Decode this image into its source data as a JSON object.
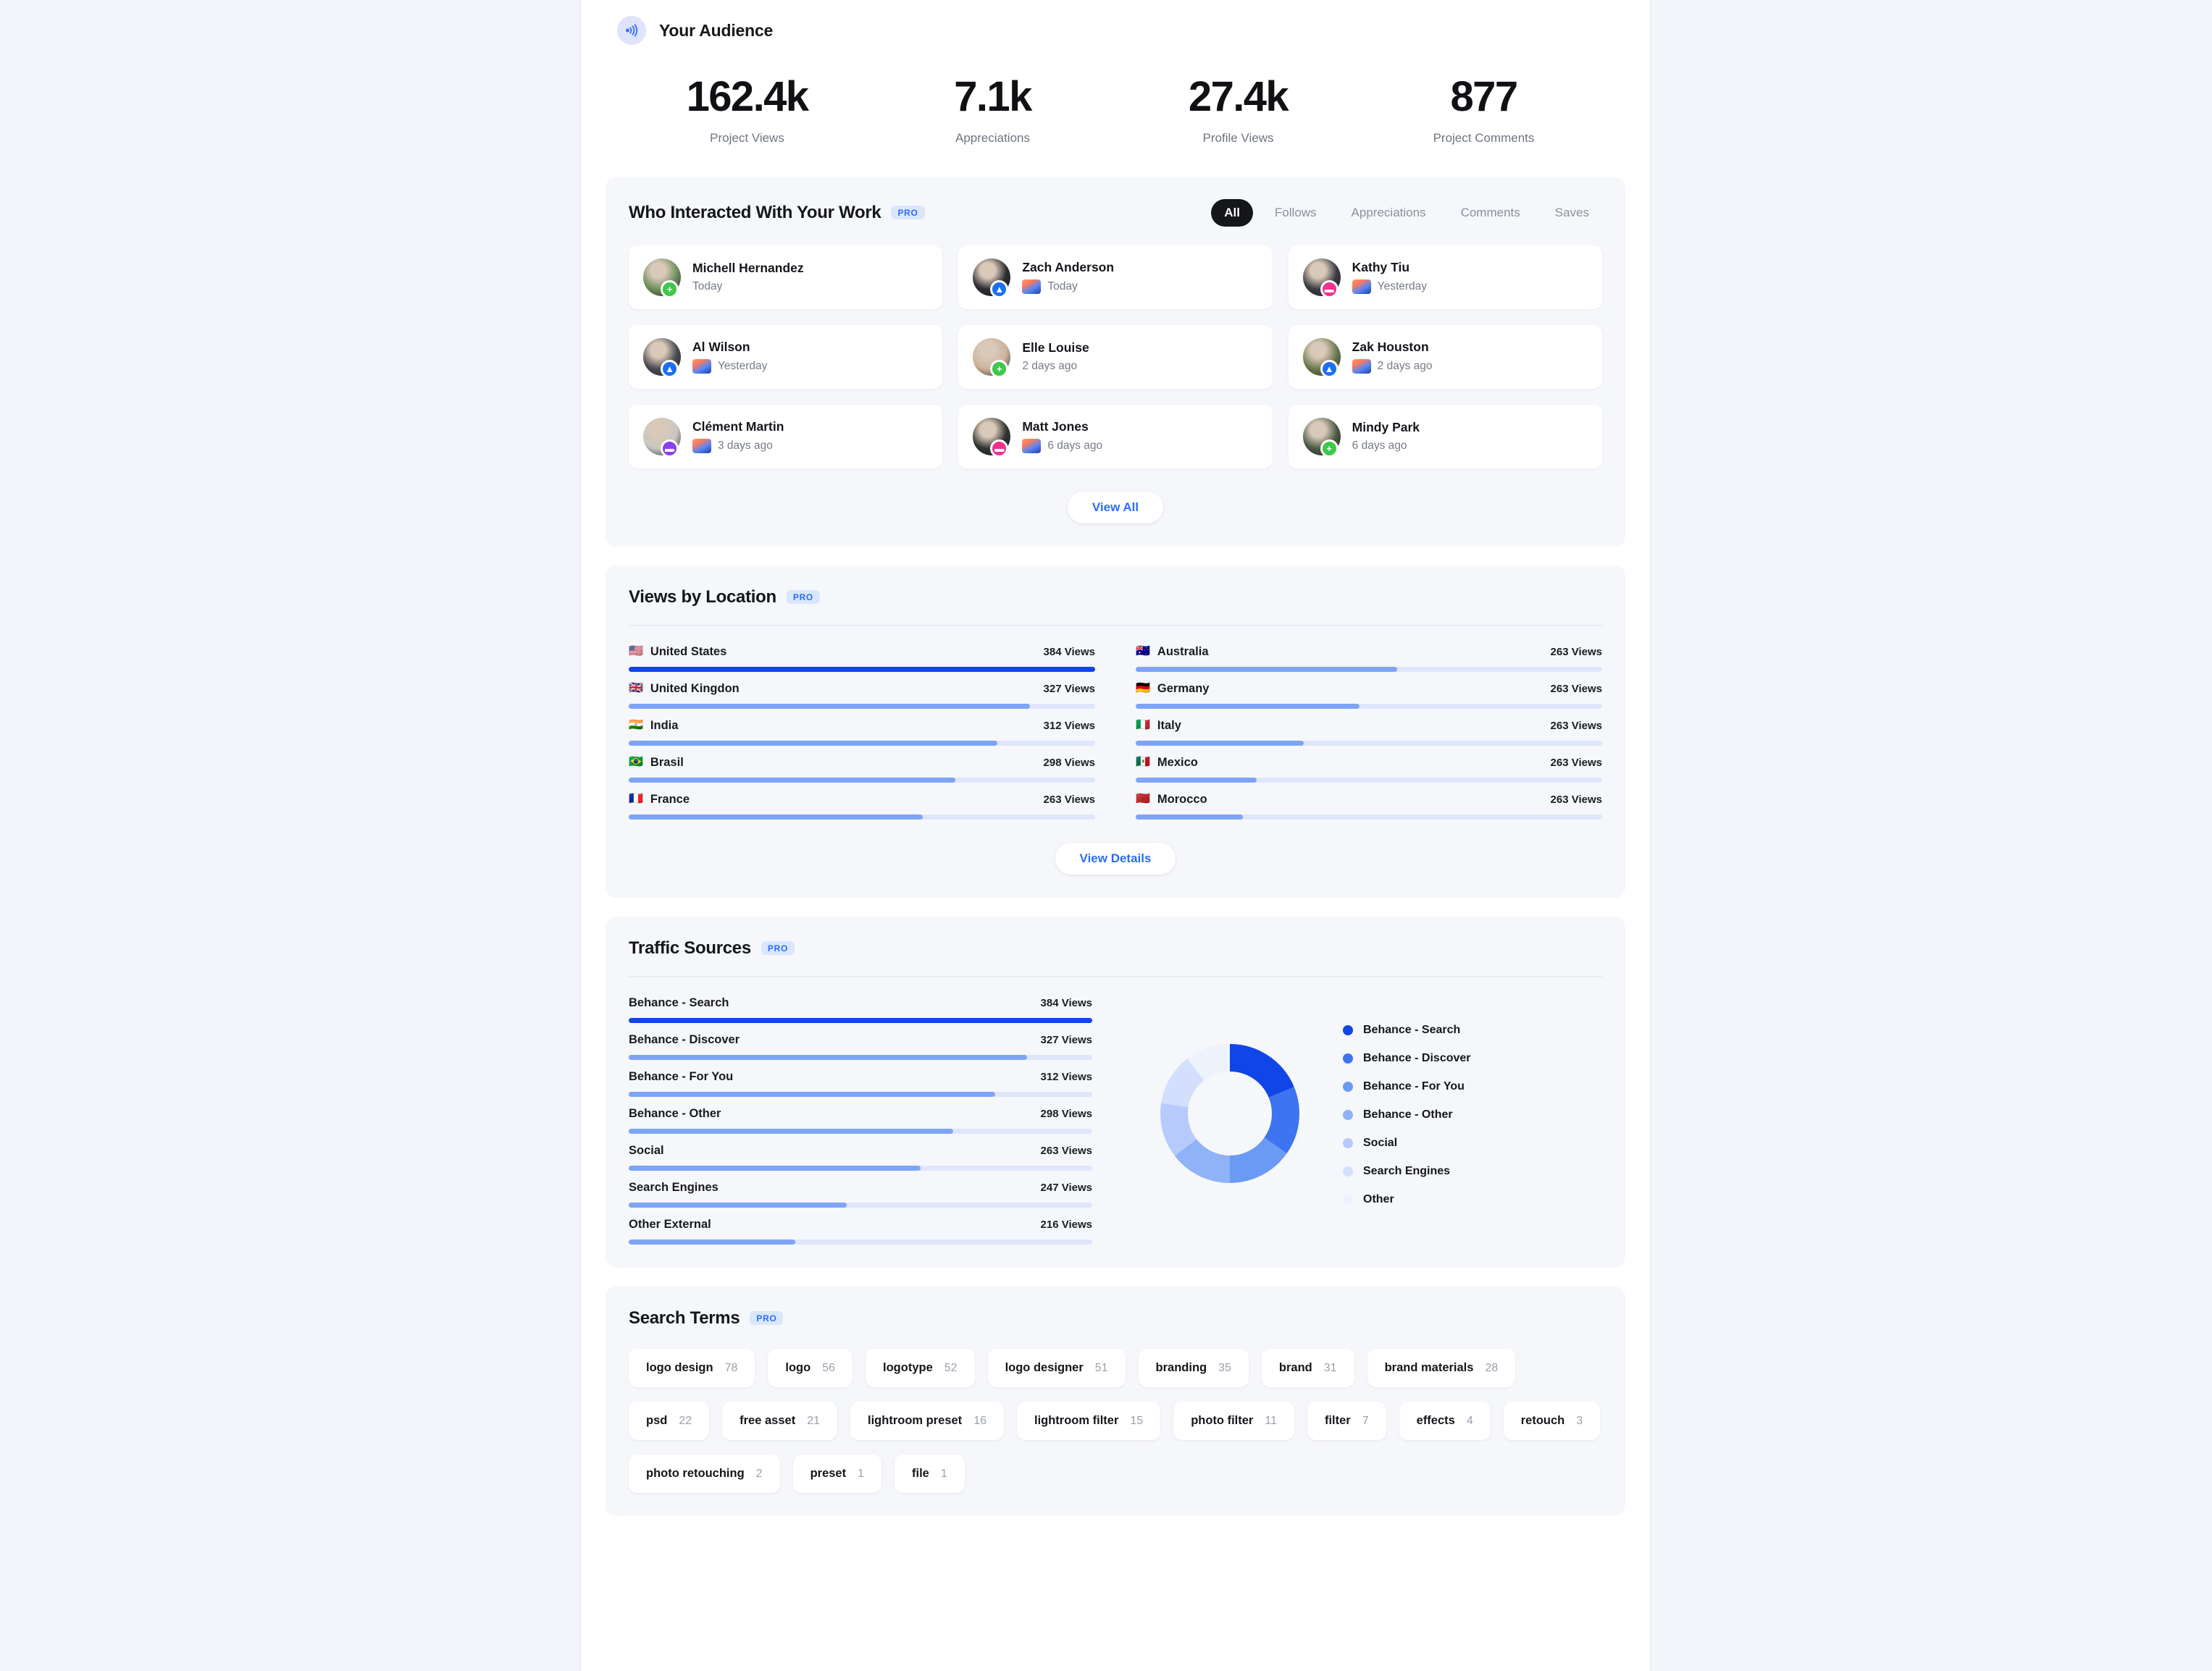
{
  "audience": {
    "icon": "broadcast-icon",
    "title": "Your Audience",
    "stats": [
      {
        "value": "162.4k",
        "label": "Project Views"
      },
      {
        "value": "7.1k",
        "label": "Appreciations"
      },
      {
        "value": "27.4k",
        "label": "Profile Views"
      },
      {
        "value": "877",
        "label": "Project Comments"
      }
    ]
  },
  "interacted": {
    "title": "Who Interacted With Your Work",
    "pro": "PRO",
    "tabs": [
      {
        "label": "All",
        "active": true
      },
      {
        "label": "Follows",
        "active": false
      },
      {
        "label": "Appreciations",
        "active": false
      },
      {
        "label": "Comments",
        "active": false
      },
      {
        "label": "Saves",
        "active": false
      }
    ],
    "people": [
      {
        "name": "Michell Hernandez",
        "time": "Today",
        "badge": "follow",
        "thumb": false,
        "avatar": "#6f8f5d"
      },
      {
        "name": "Zach Anderson",
        "time": "Today",
        "badge": "appreciation",
        "thumb": true,
        "avatar": "#2b2b30"
      },
      {
        "name": "Kathy Tiu",
        "time": "Yesterday",
        "badge": "save",
        "thumb": true,
        "avatar": "#3a3a42"
      },
      {
        "name": "Al Wilson",
        "time": "Yesterday",
        "badge": "appreciation",
        "thumb": true,
        "avatar": "#4a4a52"
      },
      {
        "name": "Elle Louise",
        "time": "2 days ago",
        "badge": "follow",
        "thumb": false,
        "avatar": "#cbb39a"
      },
      {
        "name": "Zak Houston",
        "time": "2 days ago",
        "badge": "appreciation",
        "thumb": true,
        "avatar": "#6d7a4e"
      },
      {
        "name": "Clément Martin",
        "time": "3 days ago",
        "badge": "comment",
        "thumb": true,
        "avatar": "#c9c6c0"
      },
      {
        "name": "Matt Jones",
        "time": "6 days ago",
        "badge": "save",
        "thumb": true,
        "avatar": "#2f3330"
      },
      {
        "name": "Mindy Park",
        "time": "6 days ago",
        "badge": "follow",
        "thumb": false,
        "avatar": "#4b5a44"
      }
    ],
    "view_all_label": "View All"
  },
  "locations": {
    "title": "Views by Location",
    "pro": "PRO",
    "view_details_label": "View Details",
    "unit": "Views",
    "left": [
      {
        "flag": "🇺🇸",
        "name": "United States",
        "value": "384 Views",
        "pct": 100
      },
      {
        "flag": "🇬🇧",
        "name": "United Kingdon",
        "value": "327 Views",
        "pct": 86
      },
      {
        "flag": "🇮🇳",
        "name": "India",
        "value": "312 Views",
        "pct": 79
      },
      {
        "flag": "🇧🇷",
        "name": "Brasil",
        "value": "298 Views",
        "pct": 70
      },
      {
        "flag": "🇫🇷",
        "name": "France",
        "value": "263 Views",
        "pct": 63
      }
    ],
    "right": [
      {
        "flag": "🇦🇺",
        "name": "Australia",
        "value": "263 Views",
        "pct": 56
      },
      {
        "flag": "🇩🇪",
        "name": "Germany",
        "value": "263 Views",
        "pct": 48
      },
      {
        "flag": "🇮🇹",
        "name": "Italy",
        "value": "263 Views",
        "pct": 36
      },
      {
        "flag": "🇲🇽",
        "name": "Mexico",
        "value": "263 Views",
        "pct": 26
      },
      {
        "flag": "🇲🇦",
        "name": "Morocco",
        "value": "263 Views",
        "pct": 23
      }
    ]
  },
  "traffic": {
    "title": "Traffic Sources",
    "pro": "PRO",
    "chart_data": {
      "type": "bar",
      "title": "Traffic Sources",
      "xlabel": "",
      "ylabel": "Views",
      "categories": [
        "Behance - Search",
        "Behance - Discover",
        "Behance - For You",
        "Behance - Other",
        "Social",
        "Search Engines",
        "Other External"
      ],
      "values": [
        384,
        327,
        312,
        298,
        263,
        247,
        216
      ],
      "value_labels": [
        "384 Views",
        "327 Views",
        "312 Views",
        "298 Views",
        "263 Views",
        "247 Views",
        "216 Views"
      ],
      "pct": [
        100,
        86,
        79,
        70,
        63,
        47,
        36
      ],
      "colors": [
        "#1045e8",
        "#6a9af4",
        "#7ea4f6",
        "#8fb2f8",
        "#b6cbfb",
        "#cfdcfd",
        "#eef2fd"
      ],
      "grid": false,
      "legend_position": "right"
    },
    "donut": {
      "type": "pie",
      "title": "Traffic Sources",
      "labels": [
        "Behance - Search",
        "Behance - Discover",
        "Behance - For You",
        "Behance - Other",
        "Social",
        "Search Engines",
        "Other"
      ],
      "values": [
        384,
        327,
        312,
        298,
        263,
        247,
        216
      ],
      "colors": [
        "#1045e8",
        "#3d74f0",
        "#6a9af4",
        "#8fb2f8",
        "#b6cbfb",
        "#d3dffc",
        "#eef2fd"
      ]
    }
  },
  "search_terms": {
    "title": "Search Terms",
    "pro": "PRO",
    "terms": [
      {
        "term": "logo design",
        "count": "78"
      },
      {
        "term": "logo",
        "count": "56"
      },
      {
        "term": "logotype",
        "count": "52"
      },
      {
        "term": "logo designer",
        "count": "51"
      },
      {
        "term": "branding",
        "count": "35"
      },
      {
        "term": "brand",
        "count": "31"
      },
      {
        "term": "brand materials",
        "count": "28"
      },
      {
        "term": "psd",
        "count": "22"
      },
      {
        "term": "free asset",
        "count": "21"
      },
      {
        "term": "lightroom preset",
        "count": "16"
      },
      {
        "term": "lightroom filter",
        "count": "15"
      },
      {
        "term": "photo filter",
        "count": "11"
      },
      {
        "term": "filter",
        "count": "7"
      },
      {
        "term": "effects",
        "count": "4"
      },
      {
        "term": "retouch",
        "count": "3"
      },
      {
        "term": "photo retouching",
        "count": "2"
      },
      {
        "term": "preset",
        "count": "1"
      },
      {
        "term": "file",
        "count": "1"
      }
    ]
  }
}
